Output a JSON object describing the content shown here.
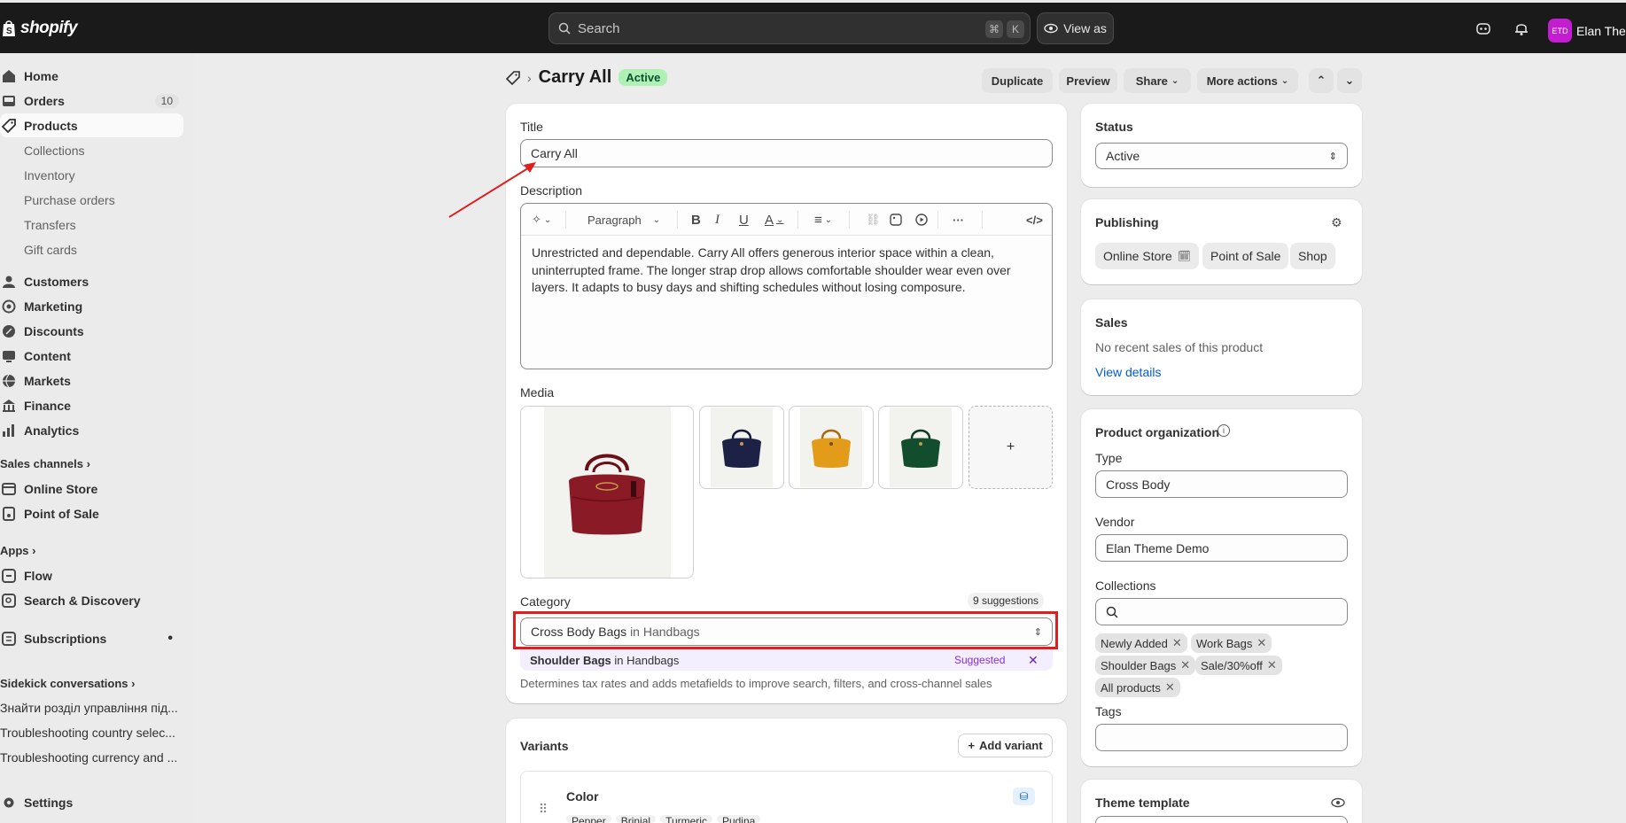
{
  "topbar": {
    "brand": "shopify",
    "search_placeholder": "Search",
    "shortcut_cmd": "⌘",
    "shortcut_key": "K",
    "view_as": "View as",
    "avatar_initials": "ETD",
    "user_name": "Elan Them"
  },
  "sidebar": {
    "home": "Home",
    "orders": "Orders",
    "orders_count": "10",
    "products": "Products",
    "products_sub": [
      "Collections",
      "Inventory",
      "Purchase orders",
      "Transfers",
      "Gift cards"
    ],
    "customers": "Customers",
    "marketing": "Marketing",
    "discounts": "Discounts",
    "content": "Content",
    "markets": "Markets",
    "finance": "Finance",
    "analytics": "Analytics",
    "sales_channels": "Sales channels",
    "online_store": "Online Store",
    "point_of_sale": "Point of Sale",
    "apps": "Apps",
    "flow": "Flow",
    "search_discovery": "Search & Discovery",
    "subscriptions": "Subscriptions",
    "sidekick": "Sidekick conversations",
    "conversations": [
      "Знайти розділ управління під...",
      "Troubleshooting country selec...",
      "Troubleshooting currency and ..."
    ],
    "settings": "Settings"
  },
  "header": {
    "title": "Carry All",
    "status_badge": "Active",
    "duplicate": "Duplicate",
    "preview": "Preview",
    "share": "Share",
    "more_actions": "More actions"
  },
  "main": {
    "title_label": "Title",
    "title_value": "Carry All",
    "description_label": "Description",
    "format": "Paragraph",
    "description": "Unrestricted and dependable. Carry All offers generous interior space within a clean, uninterrupted frame. The longer strap drop allows comfortable shoulder wear even over layers. It adapts to busy days and shifting schedules without losing composure.",
    "media_label": "Media",
    "media_add": "+",
    "category_label": "Category",
    "suggestions": "9 suggestions",
    "category_value": "Cross Body Bags",
    "category_in": "in",
    "category_parent": "Handbags",
    "suggested_value": "Shoulder Bags",
    "suggested_parent": "Handbags",
    "suggested_tag": "Suggested",
    "category_help": "Determines tax rates and adds metafields to improve search, filters, and cross-channel sales",
    "variants_label": "Variants",
    "add_variant": "Add variant",
    "option_name": "Color",
    "option_values": [
      "Pepper",
      "Brinjal",
      "Turmeric",
      "Pudina"
    ]
  },
  "right": {
    "status_label": "Status",
    "status_value": "Active",
    "publishing_label": "Publishing",
    "channels": [
      "Online Store",
      "Point of Sale",
      "Shop"
    ],
    "sales_label": "Sales",
    "sales_text": "No recent sales of this product",
    "view_details": "View details",
    "org_label": "Product organization",
    "type_label": "Type",
    "type_value": "Cross Body",
    "vendor_label": "Vendor",
    "vendor_value": "Elan Theme Demo",
    "collections_label": "Collections",
    "collections": [
      "Newly Added",
      "Work Bags",
      "Shoulder Bags",
      "Sale/30%off",
      "All products"
    ],
    "tags_label": "Tags",
    "theme_template_label": "Theme template"
  },
  "colors": {
    "accent": "#1a1a1a",
    "active_badge": "#aff0b5",
    "highlight": "#e11d1d",
    "suggested": "#8a2be2",
    "link": "#005bd3"
  }
}
